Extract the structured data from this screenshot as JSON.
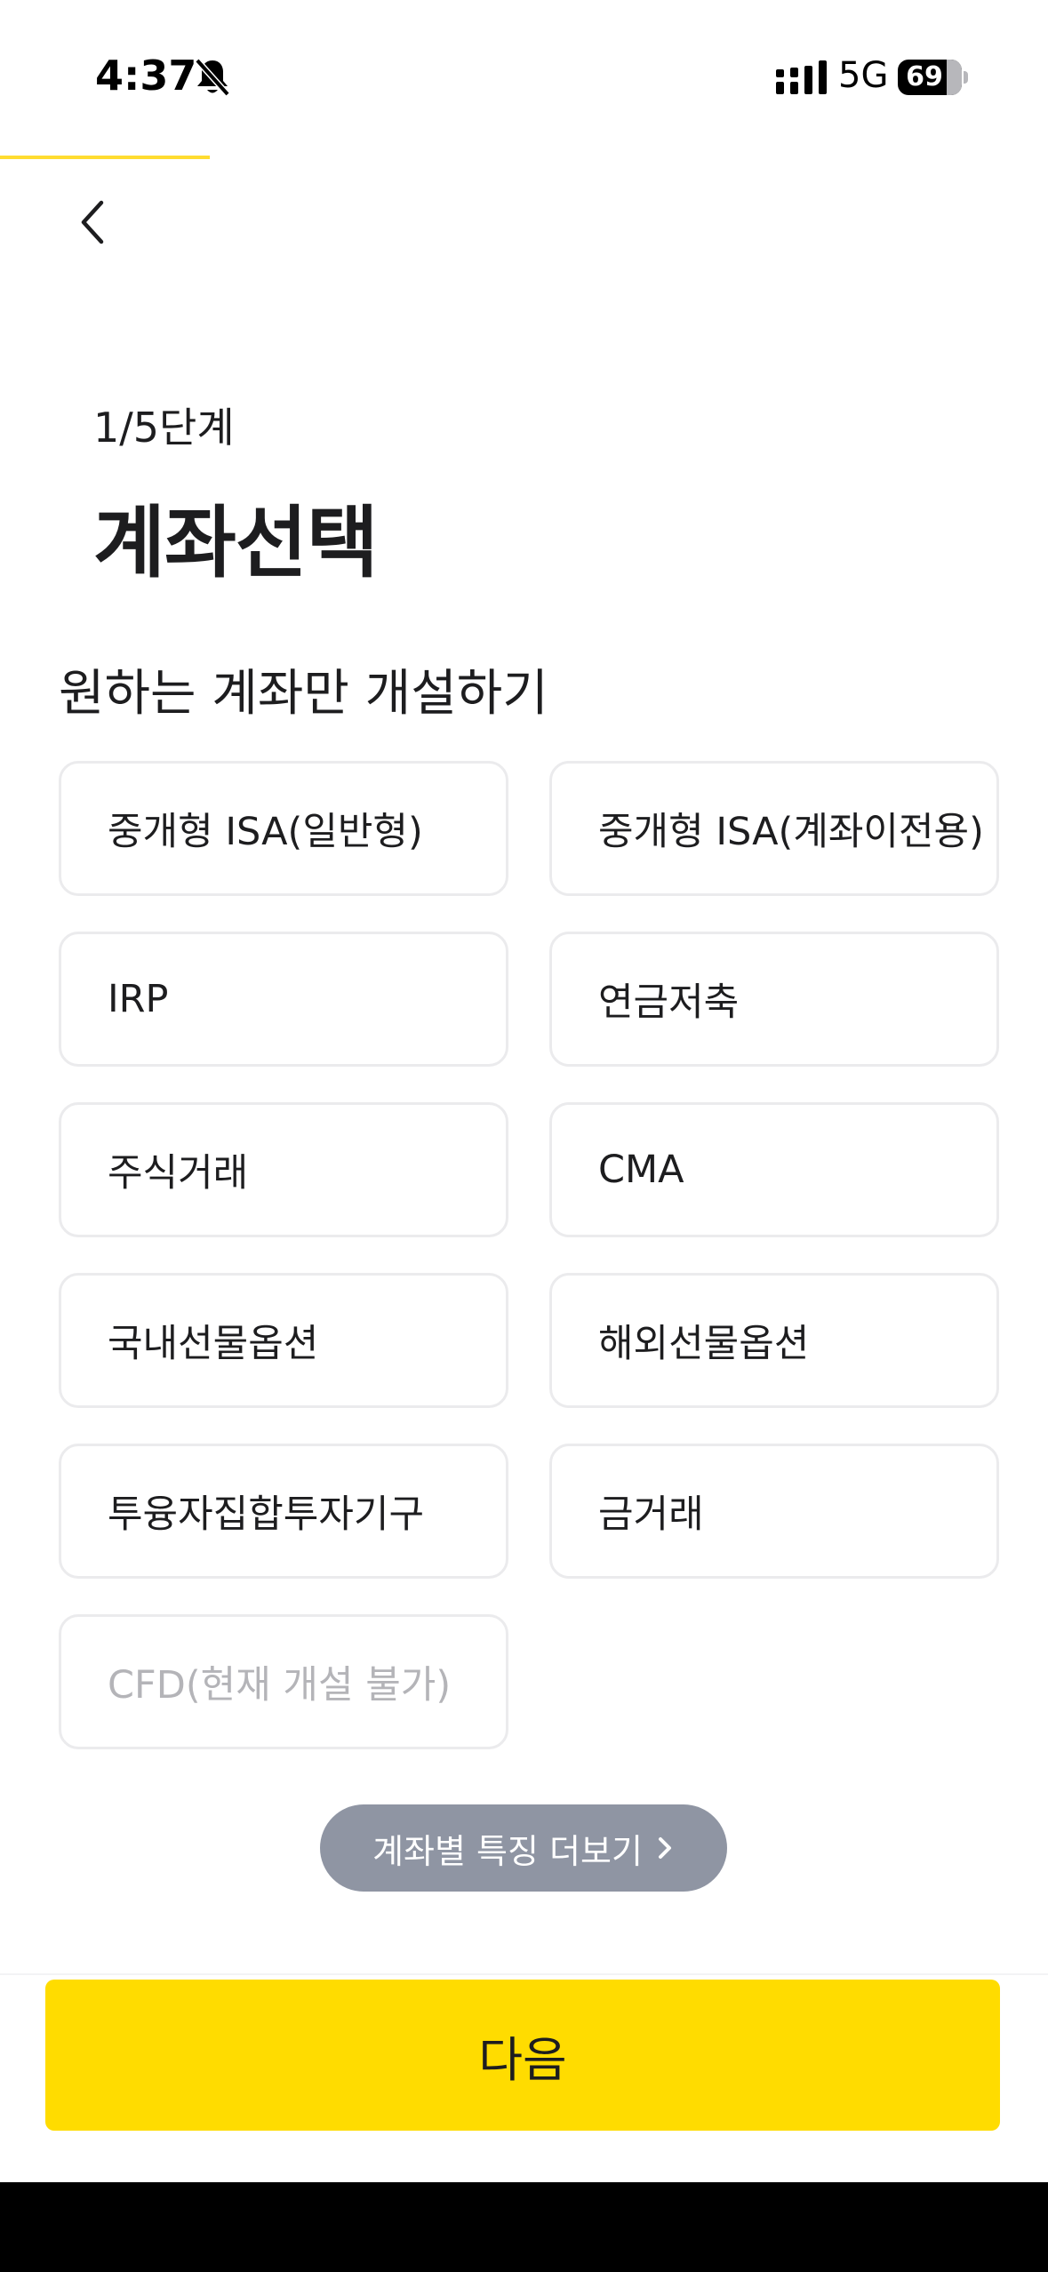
{
  "status_bar": {
    "time": "4:37",
    "network": "5G",
    "battery_percent": "69",
    "icons": [
      "bell-slash-icon",
      "signal-icon",
      "battery-icon"
    ]
  },
  "progress": {
    "current_step": 1,
    "total_steps": 5,
    "fraction": 0.2,
    "color": "#FFDC30"
  },
  "header": {
    "back_icon": "chevron-left-icon"
  },
  "step_label": "1/5단계",
  "title": "계좌선택",
  "section_title": "원하는 계좌만 개설하기",
  "options": [
    {
      "label": "중개형 ISA(일반형)",
      "enabled": true
    },
    {
      "label": "중개형 ISA(계좌이전용)",
      "enabled": true
    },
    {
      "label": "IRP",
      "enabled": true
    },
    {
      "label": "연금저축",
      "enabled": true
    },
    {
      "label": "주식거래",
      "enabled": true
    },
    {
      "label": "CMA",
      "enabled": true
    },
    {
      "label": "국내선물옵션",
      "enabled": true
    },
    {
      "label": "해외선물옵션",
      "enabled": true
    },
    {
      "label": "투융자집합투자기구",
      "enabled": true
    },
    {
      "label": "금거래",
      "enabled": true
    },
    {
      "label": "CFD(현재 개설 불가)",
      "enabled": false
    }
  ],
  "more_button": {
    "label": "계좌별 특징 더보기",
    "icon": "chevron-right-icon",
    "color": "#8F95A3"
  },
  "next_button": {
    "label": "다음",
    "color": "#FFDC00"
  }
}
